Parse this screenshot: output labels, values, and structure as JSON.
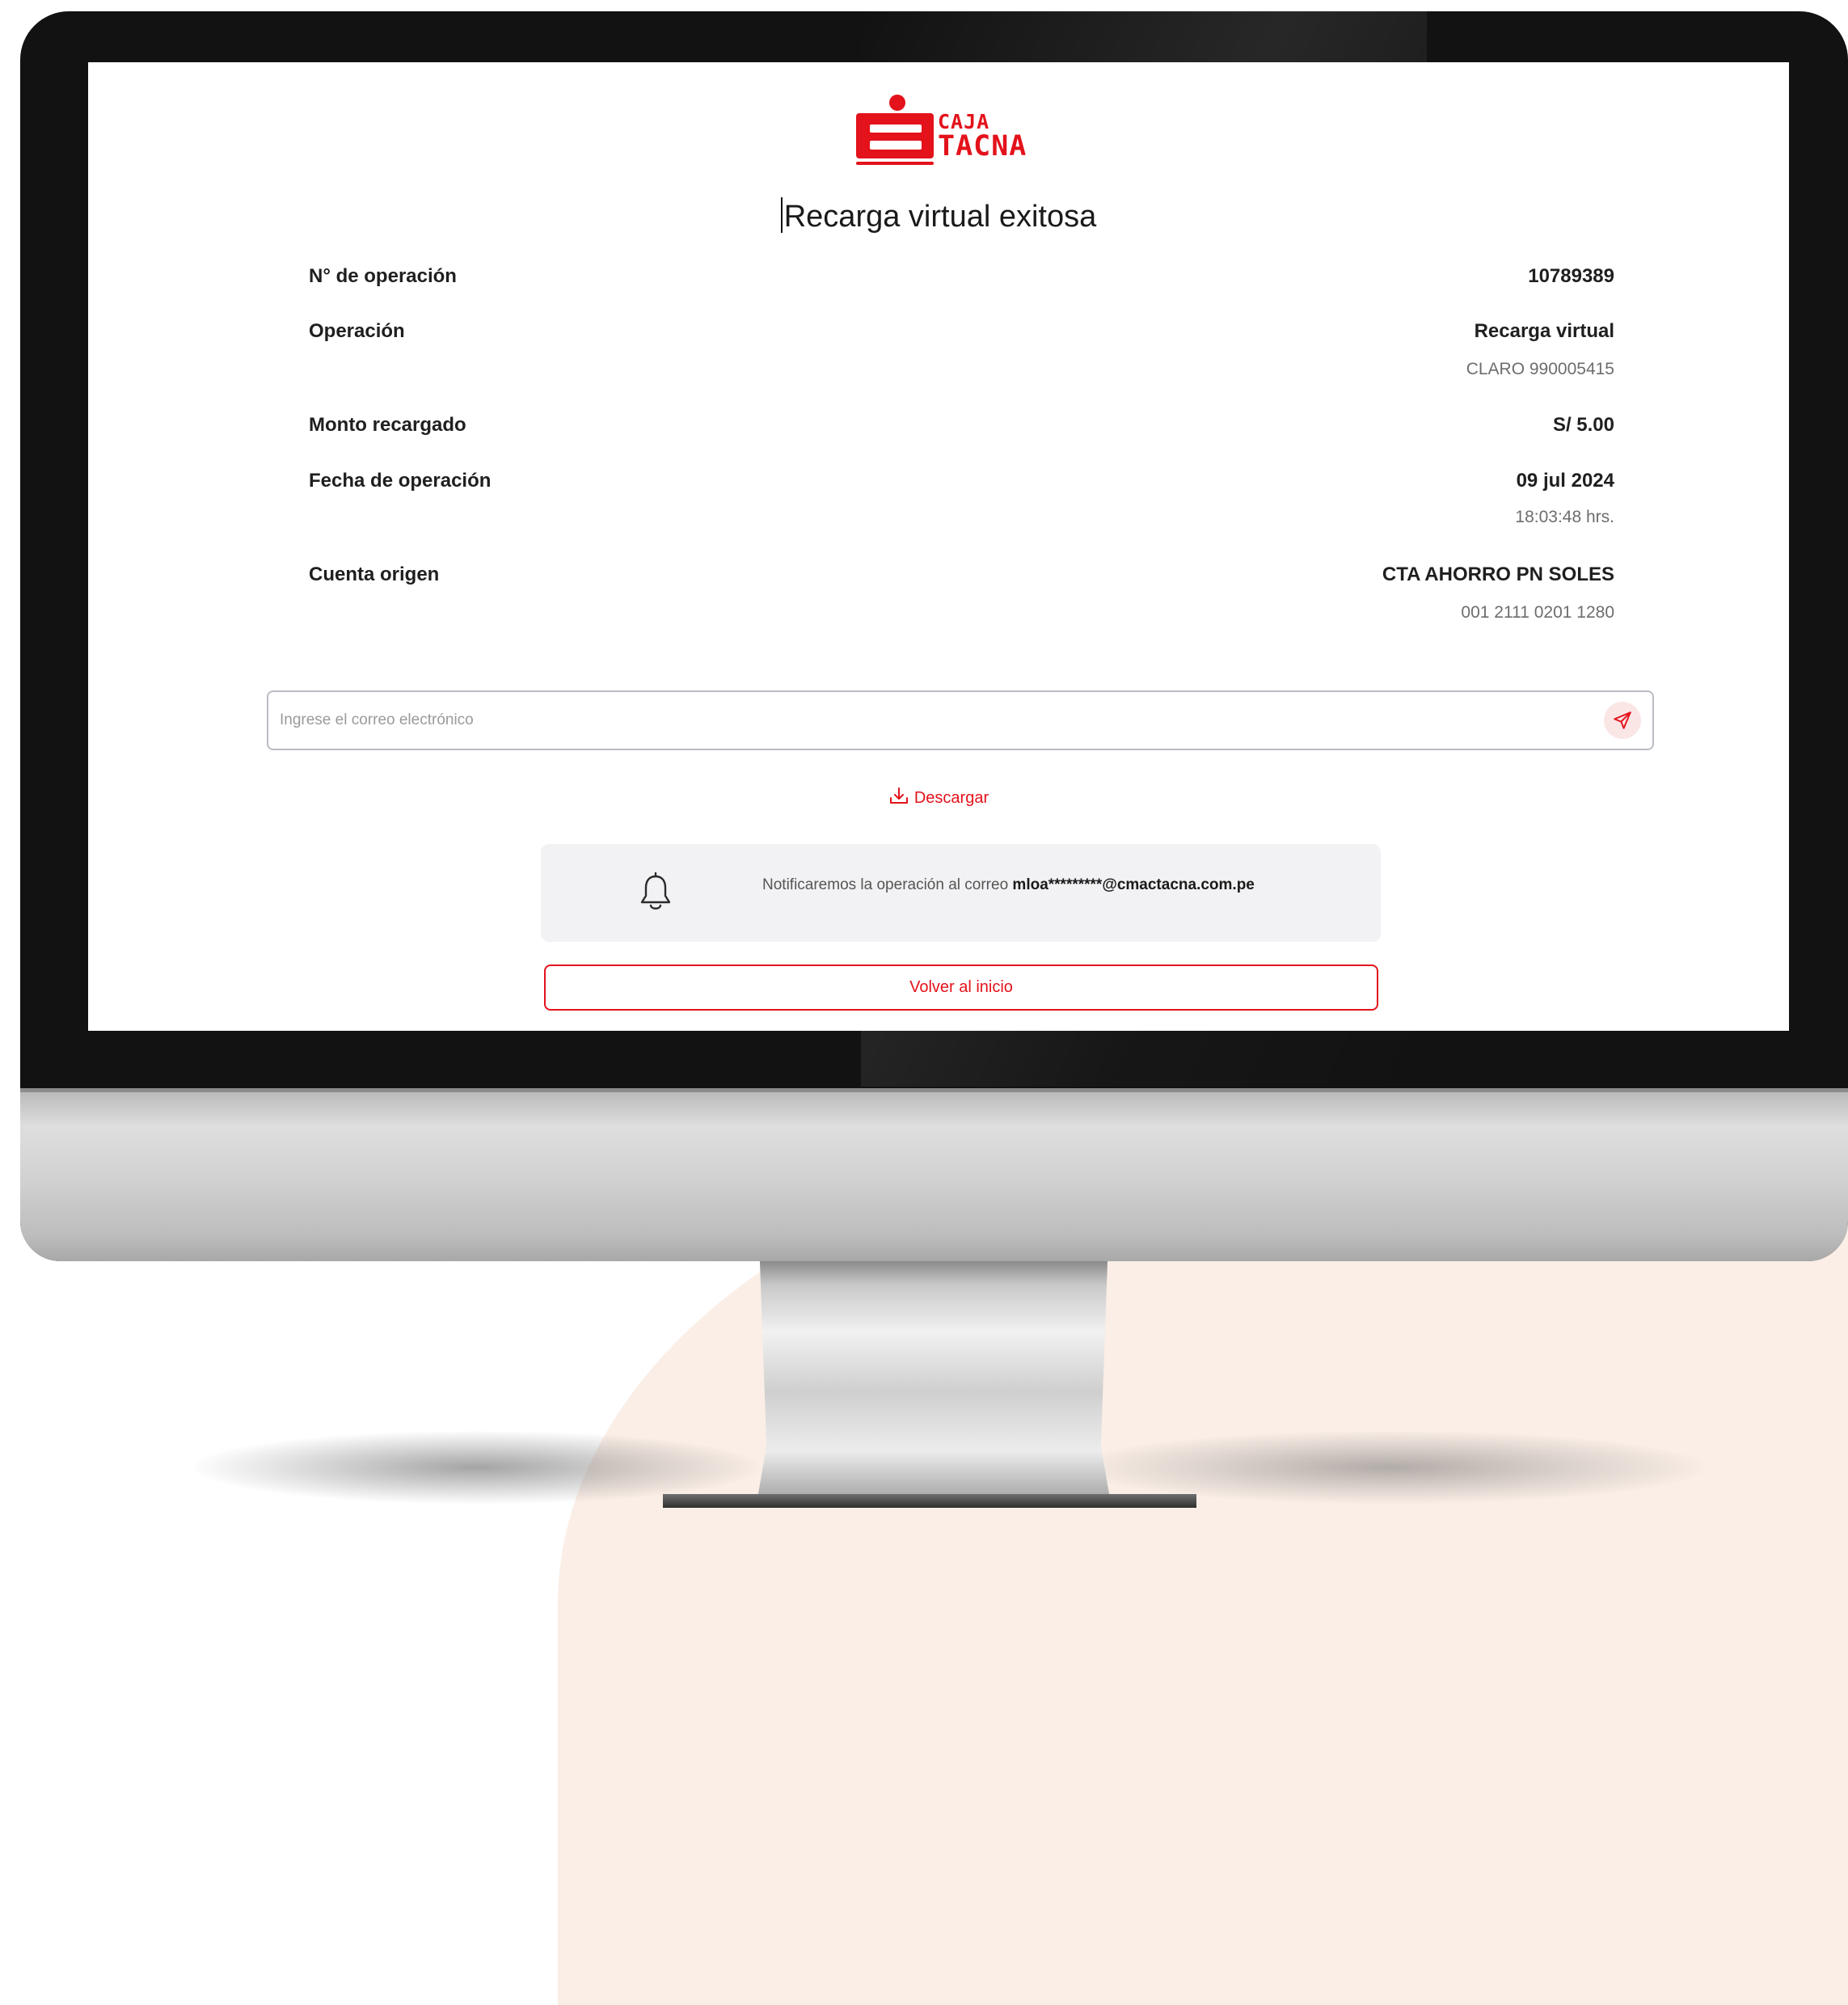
{
  "brand": {
    "line1": "CAJA",
    "line2": "TACNA",
    "color": "#e3121b"
  },
  "title": "Recarga virtual exitosa",
  "details": {
    "operation_number": {
      "label": "N° de operación",
      "value": "10789389"
    },
    "operation": {
      "label": "Operación",
      "value": "Recarga virtual",
      "sub": "CLARO 990005415"
    },
    "amount": {
      "label": "Monto recargado",
      "value": "S/ 5.00"
    },
    "date": {
      "label": "Fecha de operación",
      "value": "09 jul 2024",
      "sub": "18:03:48 hrs."
    },
    "source_account": {
      "label": "Cuenta origen",
      "value": "CTA AHORRO PN SOLES",
      "sub": "001 2111 0201 1280"
    }
  },
  "email": {
    "placeholder": "Ingrese el correo electrónico",
    "value": "",
    "send_icon": "send-icon"
  },
  "download": {
    "label": "Descargar",
    "icon": "download-icon"
  },
  "notification": {
    "icon": "bell-icon",
    "text": "Notificaremos la operación al correo",
    "email": "mloa*********@cmactacna.com.pe"
  },
  "back_button": {
    "label": "Volver al inicio"
  }
}
